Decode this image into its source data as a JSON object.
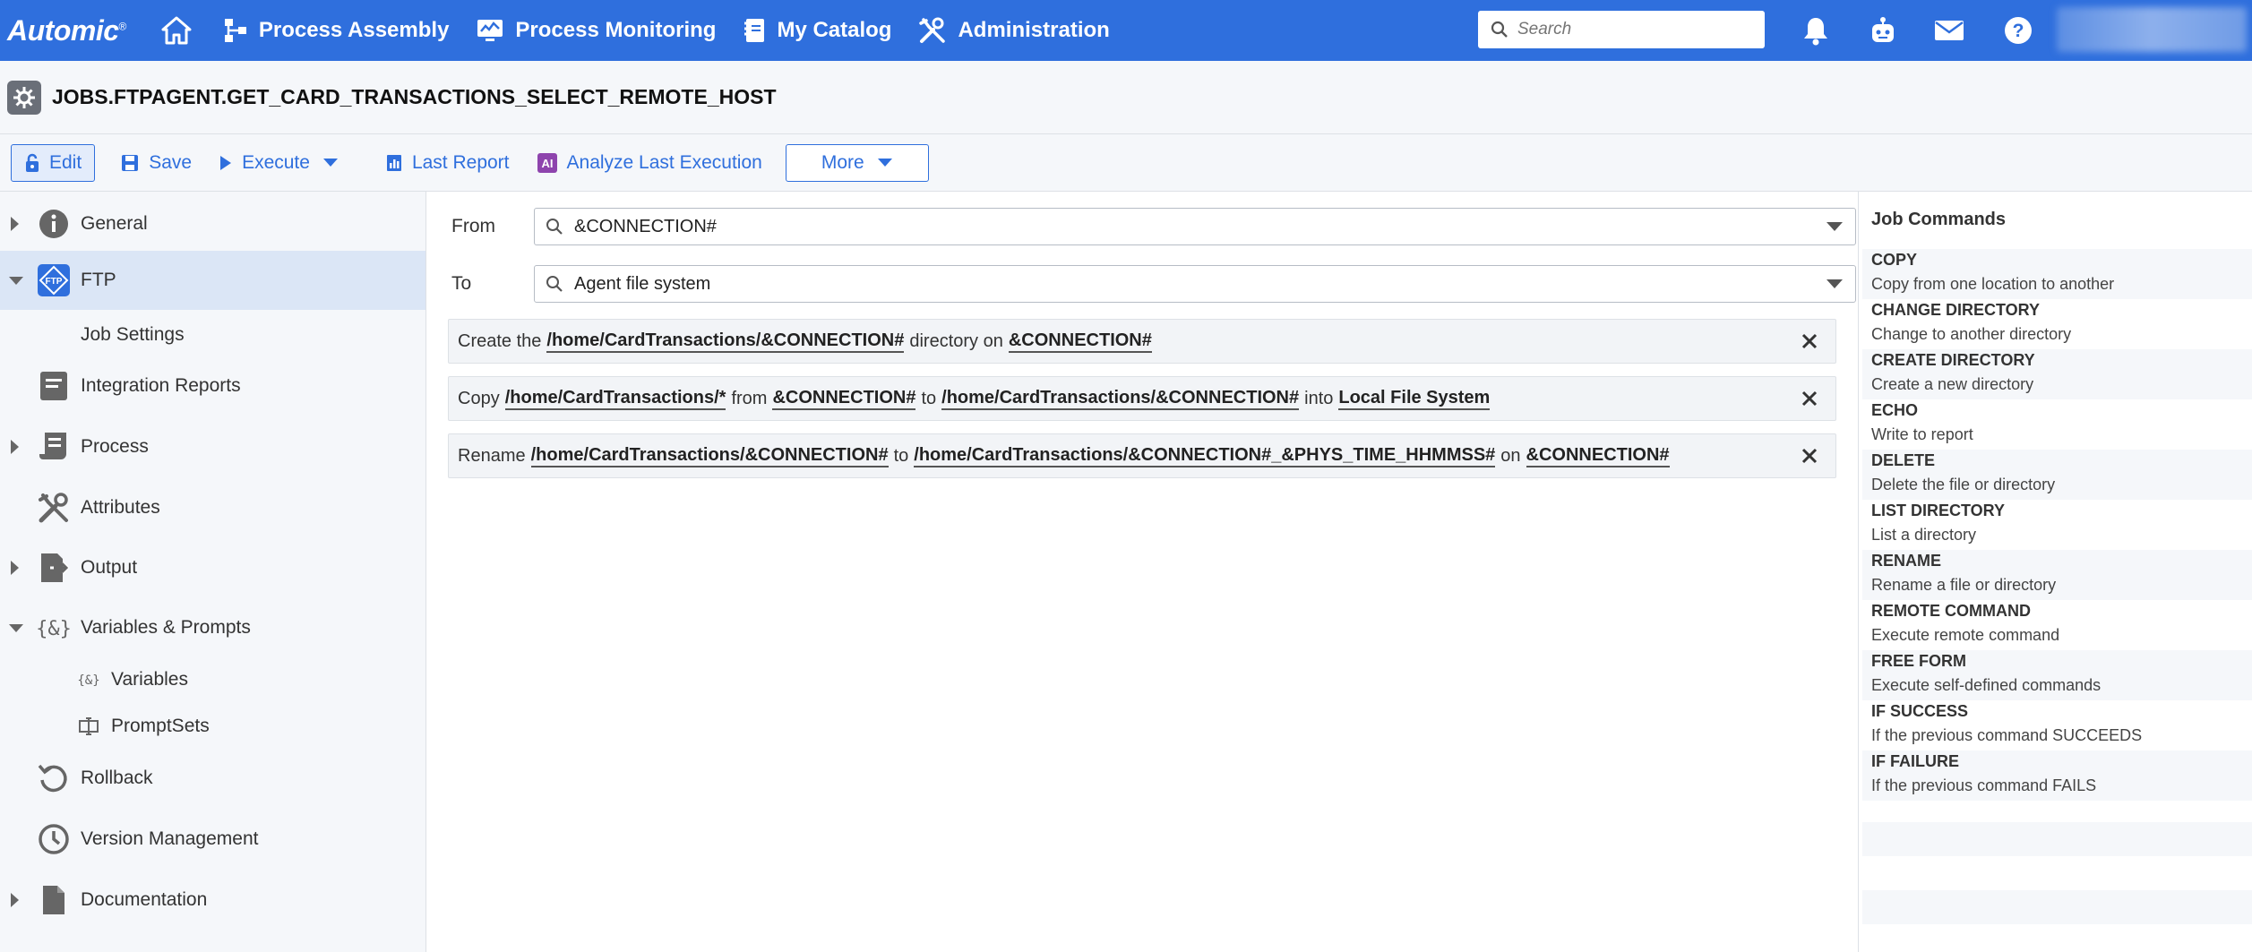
{
  "header": {
    "brand": "Automic",
    "brand_mark": "®",
    "nav": [
      {
        "label": "Process Assembly",
        "icon": "process-assembly-icon"
      },
      {
        "label": "Process Monitoring",
        "icon": "process-monitoring-icon"
      },
      {
        "label": "My Catalog",
        "icon": "catalog-icon"
      },
      {
        "label": "Administration",
        "icon": "administration-icon"
      }
    ],
    "search_placeholder": "Search"
  },
  "object": {
    "title": "JOBS.FTPAGENT.GET_CARD_TRANSACTIONS_SELECT_REMOTE_HOST"
  },
  "toolbar": {
    "edit": "Edit",
    "save": "Save",
    "execute": "Execute",
    "last_report": "Last Report",
    "analyze": "Analyze Last Execution",
    "more": "More"
  },
  "sidebar": {
    "items": [
      {
        "label": "General"
      },
      {
        "label": "FTP"
      },
      {
        "label": "Job Settings"
      },
      {
        "label": "Integration Reports"
      },
      {
        "label": "Process"
      },
      {
        "label": "Attributes"
      },
      {
        "label": "Output"
      },
      {
        "label": "Variables & Prompts"
      },
      {
        "label": "Variables"
      },
      {
        "label": "PromptSets"
      },
      {
        "label": "Rollback"
      },
      {
        "label": "Version Management"
      },
      {
        "label": "Documentation"
      }
    ]
  },
  "editor": {
    "from_label": "From",
    "from_value": "&CONNECTION#",
    "to_label": "To",
    "to_value": "Agent file system",
    "commands": [
      {
        "t1": "Create the",
        "k1": "/home/CardTransactions/&CONNECTION#",
        "t2": "directory on",
        "k2": "&CONNECTION#"
      },
      {
        "t1": "Copy",
        "k1": "/home/CardTransactions/*",
        "t2": "from",
        "k2": "&CONNECTION#",
        "t3": "to",
        "k3": "/home/CardTransactions/&CONNECTION#",
        "t4": "into",
        "k4": "Local File System"
      },
      {
        "t1": "Rename",
        "k1": "/home/CardTransactions/&CONNECTION#",
        "t2": "to",
        "k2": "/home/CardTransactions/&CONNECTION#_&PHYS_TIME_HHMMSS#",
        "t3": "on",
        "k3": "&CONNECTION#"
      }
    ]
  },
  "job_commands": {
    "title": "Job Commands",
    "items": [
      {
        "name": "COPY",
        "desc": "Copy from one location to another"
      },
      {
        "name": "CHANGE DIRECTORY",
        "desc": "Change to another directory"
      },
      {
        "name": "CREATE DIRECTORY",
        "desc": "Create a new directory"
      },
      {
        "name": "ECHO",
        "desc": "Write to report"
      },
      {
        "name": "DELETE",
        "desc": "Delete the file or directory"
      },
      {
        "name": "LIST DIRECTORY",
        "desc": "List a directory"
      },
      {
        "name": "RENAME",
        "desc": "Rename a file or directory"
      },
      {
        "name": "REMOTE COMMAND",
        "desc": "Execute remote command"
      },
      {
        "name": "FREE FORM",
        "desc": "Execute self-defined commands"
      },
      {
        "name": "IF SUCCESS",
        "desc": "If the previous command SUCCEEDS"
      },
      {
        "name": "IF FAILURE",
        "desc": "If the previous command FAILS"
      }
    ]
  },
  "colors": {
    "brand_blue": "#2f6fdd",
    "active_row": "#dbe6f6",
    "panel_bg": "#f5f7fa"
  }
}
